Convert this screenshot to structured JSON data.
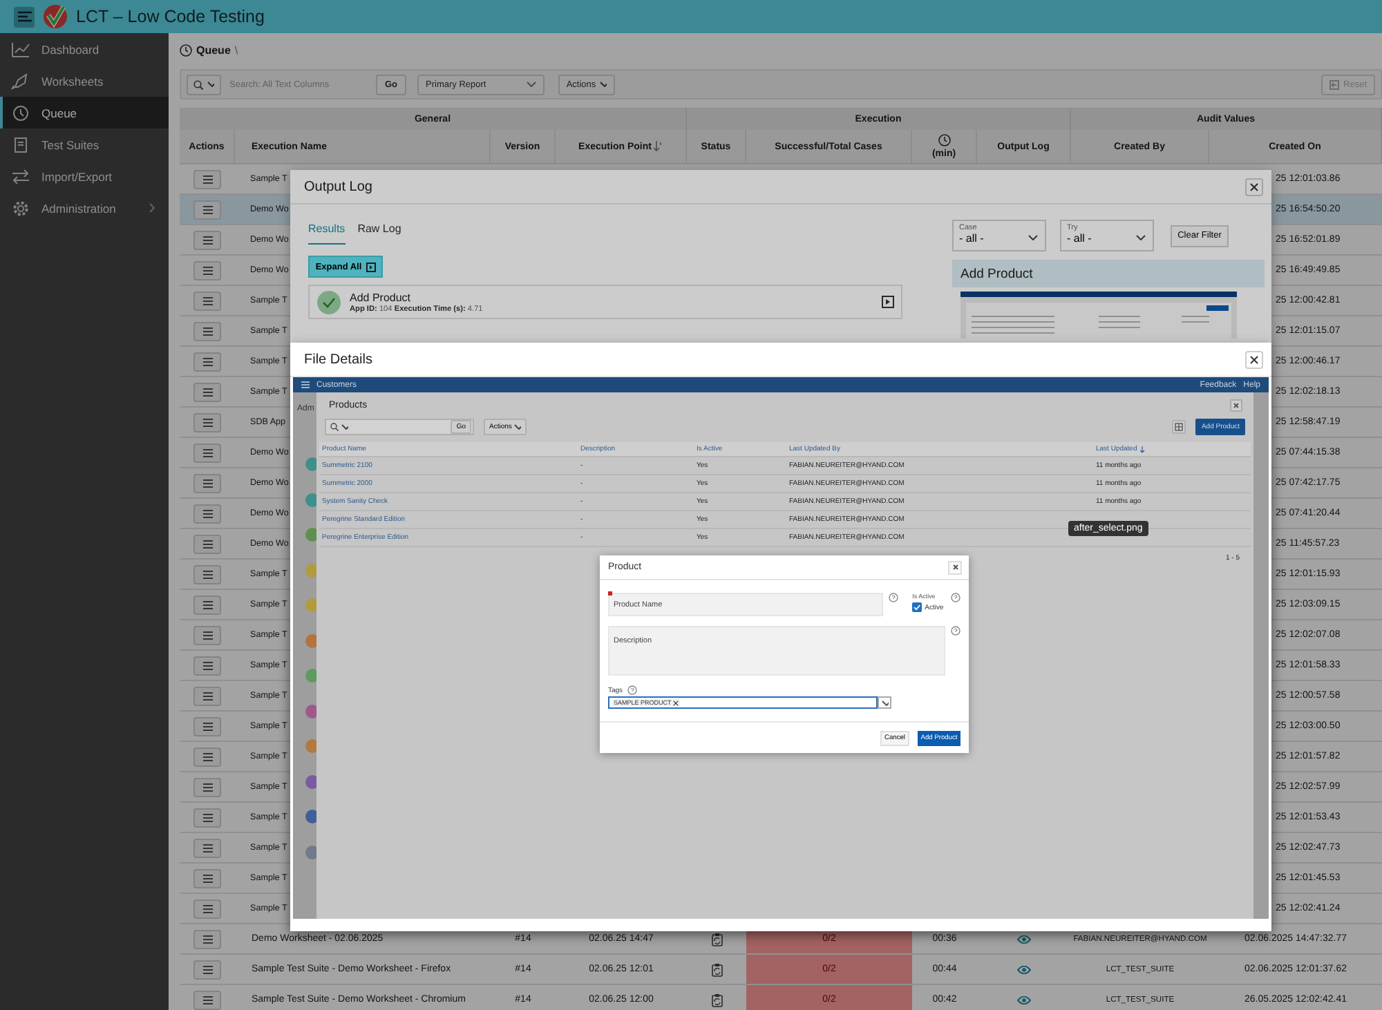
{
  "header": {
    "title": "LCT – Low Code Testing"
  },
  "sidebar": {
    "items": [
      {
        "label": "Dashboard",
        "selected": false,
        "expandable": false
      },
      {
        "label": "Worksheets",
        "selected": false,
        "expandable": false
      },
      {
        "label": "Queue",
        "selected": true,
        "expandable": false
      },
      {
        "label": "Test Suites",
        "selected": false,
        "expandable": false
      },
      {
        "label": "Import/Export",
        "selected": false,
        "expandable": false
      },
      {
        "label": "Administration",
        "selected": false,
        "expandable": true
      }
    ]
  },
  "breadcrumb": {
    "title": "Queue",
    "separator": "\\"
  },
  "toolbar": {
    "search_placeholder": "Search: All Text Columns",
    "go": "Go",
    "report": "Primary Report",
    "actions": "Actions",
    "reset": "Reset"
  },
  "table": {
    "groups": [
      {
        "label": "General",
        "columns": [
          "Actions",
          "Execution Name",
          "Version",
          "Execution Point"
        ]
      },
      {
        "label": "Execution",
        "columns": [
          "Status",
          "Successful/Total Cases",
          "(min)",
          "Output Log"
        ]
      },
      {
        "label": "Audit Values",
        "columns": [
          "Created By",
          "Created On"
        ]
      }
    ],
    "rows": [
      {
        "kind": "covered",
        "name": "Sample T",
        "created_on": "25 12:01:03.86",
        "selected": false
      },
      {
        "kind": "covered",
        "name": "Demo Wo",
        "created_on": "25 16:54:50.20",
        "selected": true
      },
      {
        "kind": "covered",
        "name": "Demo Wo",
        "created_on": "25 16:52:01.89",
        "selected": false
      },
      {
        "kind": "covered",
        "name": "Demo Wo",
        "created_on": "25 16:49:49.85",
        "selected": false
      },
      {
        "kind": "covered",
        "name": "Sample T",
        "created_on": "25 12:00:42.81",
        "selected": false
      },
      {
        "kind": "covered",
        "name": "Sample T",
        "created_on": "25 12:01:15.07",
        "selected": false
      },
      {
        "kind": "covered",
        "name": "Sample T",
        "created_on": "25 12:00:46.17",
        "selected": false
      },
      {
        "kind": "covered",
        "name": "Sample T",
        "created_on": "25 12:02:18.13",
        "selected": false
      },
      {
        "kind": "covered",
        "name": "SDB App",
        "created_on": "25 12:58:47.19",
        "selected": false
      },
      {
        "kind": "covered",
        "name": "Demo Wo",
        "created_on": "25 07:44:15.38",
        "selected": false
      },
      {
        "kind": "covered",
        "name": "Demo Wo",
        "created_on": "25 07:42:17.75",
        "selected": false
      },
      {
        "kind": "covered",
        "name": "Demo Wo",
        "created_on": "25 07:41:20.44",
        "selected": false
      },
      {
        "kind": "covered",
        "name": "Demo Wo",
        "created_on": "25 11:45:57.23",
        "selected": false
      },
      {
        "kind": "covered",
        "name": "Sample T",
        "created_on": "25 12:01:15.93",
        "selected": false
      },
      {
        "kind": "covered",
        "name": "Sample T",
        "created_on": "25 12:03:09.15",
        "selected": false
      },
      {
        "kind": "covered",
        "name": "Sample T",
        "created_on": "25 12:02:07.08",
        "selected": false
      },
      {
        "kind": "covered",
        "name": "Sample T",
        "created_on": "25 12:01:58.33",
        "selected": false
      },
      {
        "kind": "covered",
        "name": "Sample T",
        "created_on": "25 12:00:57.58",
        "selected": false
      },
      {
        "kind": "covered",
        "name": "Sample T",
        "created_on": "25 12:03:00.50",
        "selected": false
      },
      {
        "kind": "covered",
        "name": "Sample T",
        "created_on": "25 12:01:57.82",
        "selected": false
      },
      {
        "kind": "covered",
        "name": "Sample T",
        "created_on": "25 12:02:57.99",
        "selected": false
      },
      {
        "kind": "covered",
        "name": "Sample T",
        "created_on": "25 12:01:53.43",
        "selected": false
      },
      {
        "kind": "covered",
        "name": "Sample T",
        "created_on": "25 12:02:47.73",
        "selected": false
      },
      {
        "kind": "covered",
        "name": "Sample T",
        "created_on": "25 12:01:45.53",
        "selected": false
      },
      {
        "kind": "covered",
        "name": "Sample T",
        "created_on": "25 12:02:41.24",
        "selected": false
      },
      {
        "kind": "full",
        "name": "Demo Worksheet - 02.06.2025",
        "version": "#14",
        "point": "02.06.25 14:47",
        "cases": "0/2",
        "failed": true,
        "minutes": "00:36",
        "created_by": "FABIAN.NEUREITER@HYAND.COM",
        "created_on": "02.06.2025 14:47:32.77",
        "selected": false
      },
      {
        "kind": "full",
        "name": "Sample Test Suite - Demo Worksheet - Firefox",
        "version": "#14",
        "point": "02.06.25 12:01",
        "cases": "0/2",
        "failed": true,
        "minutes": "00:44",
        "created_by": "LCT_TEST_SUITE",
        "created_on": "02.06.2025 12:01:37.62",
        "selected": false
      },
      {
        "kind": "full",
        "name": "Sample Test Suite - Demo Worksheet - Chromium",
        "version": "#14",
        "point": "02.06.25 12:00",
        "cases": "0/2",
        "failed": true,
        "minutes": "00:42",
        "created_by": "LCT_TEST_SUITE",
        "created_on": "26.05.2025 12:02:42.41",
        "selected": false
      }
    ]
  },
  "output_log": {
    "title": "Output Log",
    "tabs": [
      {
        "label": "Results",
        "selected": true
      },
      {
        "label": "Raw Log",
        "selected": false
      }
    ],
    "expand_all": "Expand All",
    "results": [
      {
        "title": "Add Product",
        "details": "**App ID:** 104 **Execution Time (s):** 4.71",
        "passed": true
      }
    ],
    "filters": [
      {
        "label": "Case",
        "value": "- all -"
      },
      {
        "label": "Try",
        "value": "- all -"
      }
    ],
    "clear_filter": "Clear Filter",
    "preview_title": "Add Product"
  },
  "file_details": {
    "title": "File Details",
    "tooltip": "after_select.png",
    "screenshot": {
      "app_title": "Customers",
      "nav_links": [
        "Feedback",
        "Help"
      ],
      "side_label": "Adm",
      "avatars": [
        {
          "color": "#3f8f8c"
        },
        {
          "color": "#3f8f8c"
        },
        {
          "color": "#5f8f4f"
        },
        {
          "color": "#b39a3f"
        },
        {
          "color": "#b39a3f"
        },
        {
          "color": "#b3743f"
        },
        {
          "color": "#5f9a5f"
        },
        {
          "color": "#a0588a"
        },
        {
          "color": "#b37a3f"
        },
        {
          "color": "#7a5aa0"
        },
        {
          "color": "#3f5f9a"
        },
        {
          "color": "#6f7a8a"
        }
      ],
      "products": {
        "title": "Products",
        "go": "Go",
        "actions": "Actions",
        "add": "Add Product",
        "columns": [
          "Product Name",
          "Description",
          "Is Active",
          "Last Updated By",
          "Last Updated"
        ],
        "rows": [
          {
            "name": "Summetric 2100",
            "description": "-",
            "active": "Yes",
            "updated_by": "FABIAN.NEUREITER@HYAND.COM",
            "updated": "11 months ago"
          },
          {
            "name": "Summetric 2000",
            "description": "-",
            "active": "Yes",
            "updated_by": "FABIAN.NEUREITER@HYAND.COM",
            "updated": "11 months ago"
          },
          {
            "name": "System Sanity Check",
            "description": "-",
            "active": "Yes",
            "updated_by": "FABIAN.NEUREITER@HYAND.COM",
            "updated": "11 months ago"
          },
          {
            "name": "Peregrine Standard Edition",
            "description": "-",
            "active": "Yes",
            "updated_by": "FABIAN.NEUREITER@HYAND.COM"
          },
          {
            "name": "Peregrine Enterprise Edition",
            "description": "-",
            "active": "Yes",
            "updated_by": "FABIAN.NEUREITER@HYAND.COM"
          }
        ],
        "pagination": "1 - 5"
      },
      "form": {
        "title": "Product",
        "name_label": "Product Name",
        "active_label": "Is Active",
        "active_option": "Active",
        "active_checked": true,
        "description_label": "Description",
        "tags_label": "Tags",
        "tags": [
          "SAMPLE PRODUCT"
        ],
        "cancel": "Cancel",
        "submit": "Add Product"
      }
    }
  }
}
